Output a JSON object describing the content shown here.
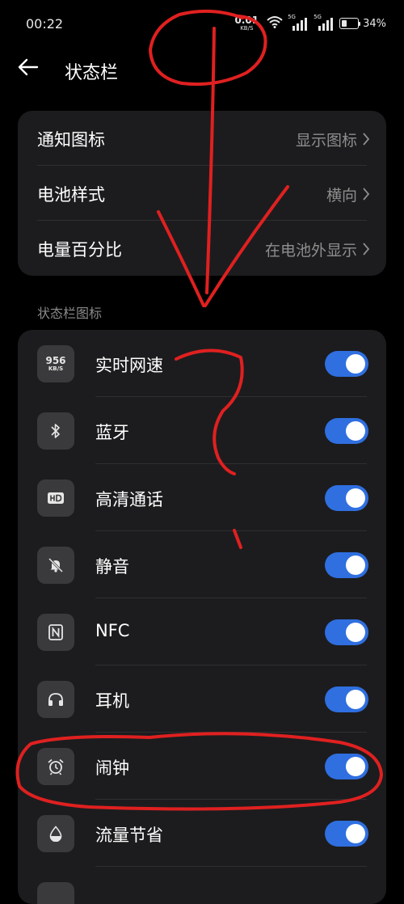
{
  "status_bar": {
    "time": "00:22",
    "net_speed": "0.01",
    "net_speed_unit": "KB/S",
    "sim1_tag": "5G",
    "sim2_tag": "5G",
    "battery": "34%",
    "battery_level": 0.34
  },
  "header": {
    "title": "状态栏"
  },
  "settings": [
    {
      "label": "通知图标",
      "value": "显示图标"
    },
    {
      "label": "电池样式",
      "value": "横向"
    },
    {
      "label": "电量百分比",
      "value": "在电池外显示"
    }
  ],
  "section_label": "状态栏图标",
  "speed_icon": {
    "value": "956",
    "unit": "KB/S"
  },
  "icons": [
    {
      "label": "实时网速",
      "icon": "net-speed-icon",
      "enabled": true
    },
    {
      "label": "蓝牙",
      "icon": "bluetooth-icon",
      "enabled": true
    },
    {
      "label": "高清通话",
      "icon": "hd-icon",
      "enabled": true
    },
    {
      "label": "静音",
      "icon": "mute-bell-icon",
      "enabled": true
    },
    {
      "label": "NFC",
      "icon": "nfc-icon",
      "enabled": true
    },
    {
      "label": "耳机",
      "icon": "headphones-icon",
      "enabled": true
    },
    {
      "label": "闹钟",
      "icon": "alarm-clock-icon",
      "enabled": true
    },
    {
      "label": "流量节省",
      "icon": "data-saver-icon",
      "enabled": true
    }
  ],
  "colors": {
    "background": "#000000",
    "card": "#1c1c1e",
    "toggle_on": "#2f6fe0",
    "annotation": "#e02020"
  }
}
